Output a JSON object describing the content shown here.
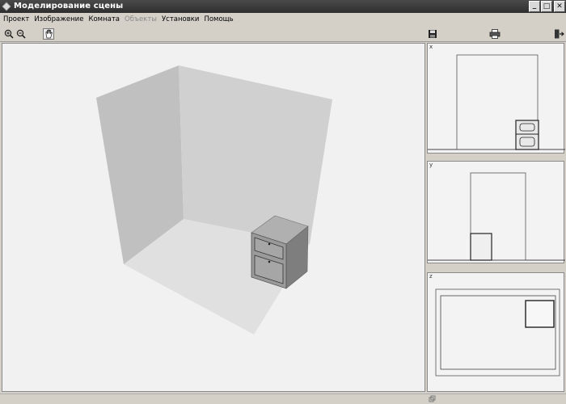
{
  "window": {
    "title": "Моделирование сцены",
    "controls": {
      "minimize": "_",
      "maximize": "□",
      "close": "✕"
    }
  },
  "menu": {
    "items": [
      {
        "label": "Проект",
        "enabled": true
      },
      {
        "label": "Изображение",
        "enabled": true
      },
      {
        "label": "Комната",
        "enabled": true
      },
      {
        "label": "Объекты",
        "enabled": false
      },
      {
        "label": "Установки",
        "enabled": true
      },
      {
        "label": "Помощь",
        "enabled": true
      }
    ]
  },
  "toolbar": {
    "zoom_in_icon": "zoom-in-icon",
    "zoom_out_icon": "zoom-out-icon",
    "pan_icon": "hand-icon",
    "save_icon": "floppy-disk-icon",
    "print_icon": "printer-icon",
    "exit_icon": "exit-door-icon"
  },
  "panels": {
    "top_mark": "x",
    "mid_mark": "y",
    "bot_mark": "z"
  },
  "colors": {
    "title_bar": "#3a3a3a",
    "window_bg": "#d4d0c8",
    "viewport_bg": "#f1f1f1",
    "wall_left": "#bebebe",
    "wall_back": "#cfcfcf",
    "floor": "#e0e0e0",
    "cabinet": "#9a9a9a"
  }
}
